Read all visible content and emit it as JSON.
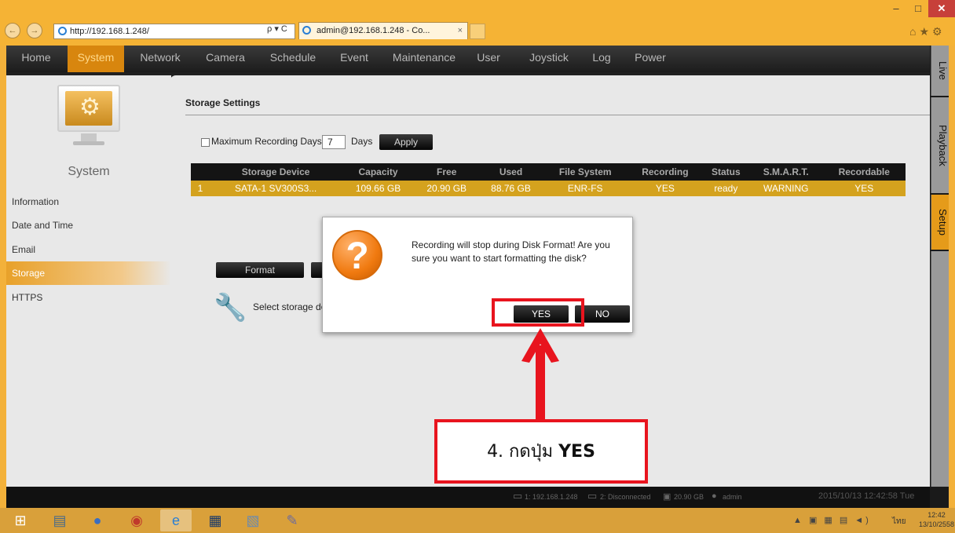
{
  "browser": {
    "url": "http://192.168.1.248/",
    "tab_title": "admin@192.168.1.248 - Co...",
    "tab_close": "×",
    "search_refresh": "ρ ▾ C",
    "controls": {
      "min": "‒",
      "max": "□",
      "close": "✕"
    },
    "back": "←",
    "forward": "→",
    "toolbar_icons": "⌂★⚙"
  },
  "menu": {
    "items": [
      "Home",
      "System",
      "Network",
      "Camera",
      "Schedule",
      "Event",
      "Maintenance",
      "User",
      "Joystick",
      "Log",
      "Power"
    ],
    "active": "System"
  },
  "side_tabs": [
    "Live",
    "Playback",
    "Setup"
  ],
  "sidebar": {
    "title": "System",
    "items": [
      "Information",
      "Date and Time",
      "Email",
      "Storage",
      "HTTPS"
    ],
    "active": "Storage"
  },
  "storage": {
    "title": "Storage Settings",
    "max_days_label": "Maximum Recording Days",
    "max_days_value": "7",
    "days_label": "Days",
    "apply_label": "Apply",
    "format_label": "Format",
    "hint": "Select storage de"
  },
  "table": {
    "headers": [
      "",
      "Storage Device",
      "Capacity",
      "Free",
      "Used",
      "File System",
      "Recording",
      "Status",
      "S.M.A.R.T.",
      "Recordable"
    ],
    "rows": [
      [
        "1",
        "SATA-1 SV300S3...",
        "109.66 GB",
        "20.90 GB",
        "88.76 GB",
        "ENR-FS",
        "YES",
        "ready",
        "WARNING",
        "YES"
      ]
    ]
  },
  "dialog": {
    "icon": "?",
    "message": "Recording will stop during Disk Format! Are you sure you want to start formatting the disk?",
    "yes_label": "YES",
    "no_label": "NO"
  },
  "annotation": {
    "prefix": "4. กดปุ่ม",
    "bold": "YES",
    "color": "#e8141e"
  },
  "statusbar": {
    "ch1": "1: 192.168.1.248",
    "ch2": "2: Disconnected",
    "disk": "20.90 GB",
    "user": "admin",
    "datetime": "2015/10/13 12:42:58 Tue"
  },
  "taskbar": {
    "time": "12:42",
    "date": "13/10/2558",
    "lang": "ไทย"
  },
  "colors": {
    "accent": "#e59b1a",
    "table_row": "#d4a21e",
    "taskbar": "#d9a03a"
  }
}
